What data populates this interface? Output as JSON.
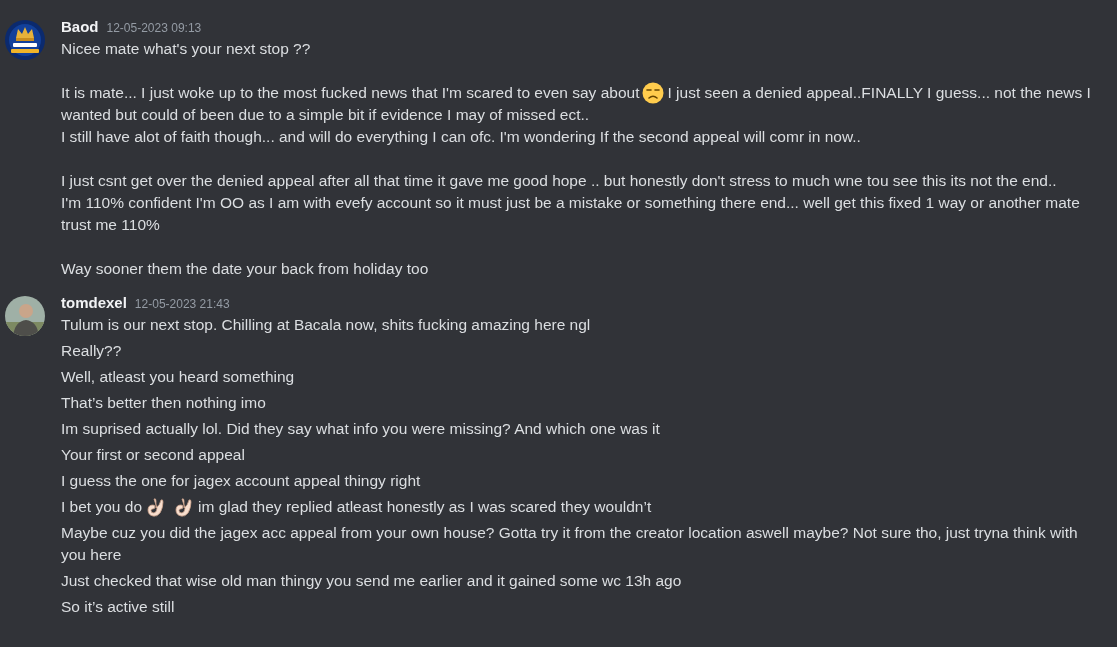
{
  "messages": [
    {
      "author": "Baod",
      "timestamp": "12-05-2023 09:13",
      "kind": "logo-avatar",
      "paragraphs": [
        {
          "lines": [
            [
              {
                "kind": "text",
                "text": "Nicee mate what's your next stop ??"
              }
            ]
          ]
        },
        {
          "lines": [
            [
              {
                "kind": "text",
                "text": "It is mate... I just woke up to the most fucked news that I'm scared to even say about"
              },
              {
                "kind": "unamused-face"
              },
              {
                "kind": "text",
                "text": "I just seen a denied appeal..FINALLY I guess... not the news I"
              }
            ],
            [
              {
                "kind": "text",
                "text": "wanted but could of been due to a simple bit if evidence I may of missed ect.."
              }
            ],
            [
              {
                "kind": "text",
                "text": "I still have alot of faith though... and will do everything I can ofc. I'm wondering If the second appeal will comr in now.."
              }
            ]
          ]
        },
        {
          "lines": [
            [
              {
                "kind": "text",
                "text": "I just csnt get over the denied appeal after all that time it gave me good hope .. but honestly don't stress to much wne tou see this  its not the end.."
              }
            ],
            [
              {
                "kind": "text",
                "text": "I'm 110% confident I'm OO as I am with evefy account so it must just be a mistake or something there end... well get this fixed 1 way or another mate  trust me 110%"
              }
            ]
          ]
        },
        {
          "lines": [
            [
              {
                "kind": "text",
                "text": "Way sooner them the date your back from holiday too"
              }
            ]
          ]
        }
      ]
    },
    {
      "author": "tomdexel",
      "timestamp": "12-05-2023 21:43",
      "kind": "person-avatar",
      "paragraphs": [
        {
          "lines": [
            [
              {
                "kind": "text",
                "text": "Tulum is our next stop. Chilling at Bacala now, shits fucking amazing here ngl"
              }
            ]
          ]
        },
        {
          "lines": [
            [
              {
                "kind": "text",
                "text": "Really??"
              }
            ]
          ]
        },
        {
          "lines": [
            [
              {
                "kind": "text",
                "text": "Well, atleast you heard something"
              }
            ]
          ]
        },
        {
          "lines": [
            [
              {
                "kind": "text",
                "text": "That’s better then nothing imo"
              }
            ]
          ]
        },
        {
          "lines": [
            [
              {
                "kind": "text",
                "text": "Im suprised actually lol. Did they say what info you were missing? And which one was it"
              }
            ]
          ]
        },
        {
          "lines": [
            [
              {
                "kind": "text",
                "text": "Your first or second appeal"
              }
            ]
          ]
        },
        {
          "lines": [
            [
              {
                "kind": "text",
                "text": "I guess the one for jagex account appeal thingy right"
              }
            ]
          ]
        },
        {
          "lines": [
            [
              {
                "kind": "text",
                "text": "I bet you do"
              },
              {
                "kind": "ok-hand"
              },
              {
                "kind": "ok-hand"
              },
              {
                "kind": "text",
                "text": "im glad they replied atleast honestly as I was scared they wouldn’t"
              }
            ]
          ]
        },
        {
          "lines": [
            [
              {
                "kind": "text",
                "text": "Maybe cuz you did the jagex acc appeal from your own house? Gotta try it from the creator location aswell maybe? Not sure tho, just tryna think with you here"
              }
            ]
          ]
        },
        {
          "lines": [
            [
              {
                "kind": "text",
                "text": "Just checked that wise old man thingy you send me earlier and it gained some wc 13h ago"
              }
            ]
          ]
        },
        {
          "lines": [
            [
              {
                "kind": "text",
                "text": "So it’s active still"
              }
            ]
          ]
        }
      ]
    }
  ]
}
